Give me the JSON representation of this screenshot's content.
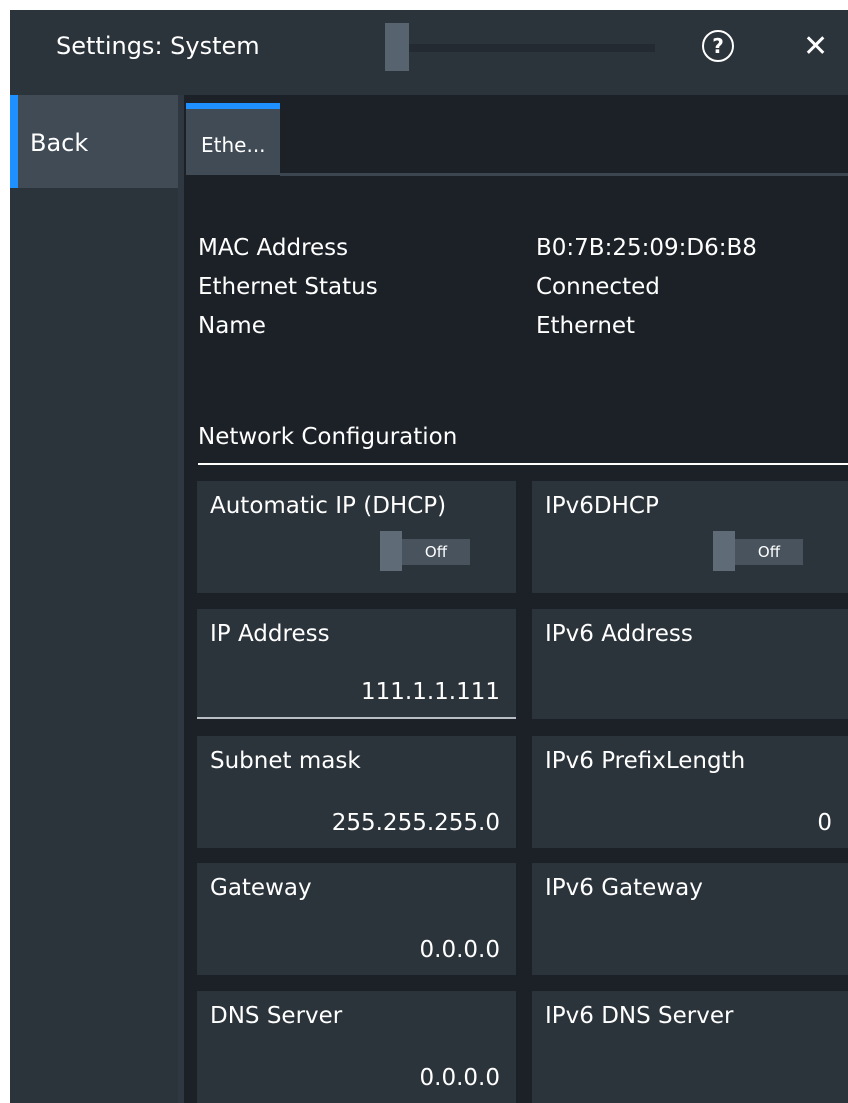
{
  "window": {
    "title": "Settings: System"
  },
  "icons": {
    "help": "?",
    "close": "✕"
  },
  "sidebar": {
    "back_label": "Back"
  },
  "tabs": [
    {
      "label": "Ethe..."
    }
  ],
  "info": {
    "mac_label": "MAC Address",
    "mac_value": "B0:7B:25:09:D6:B8",
    "status_label": "Ethernet Status",
    "status_value": "Connected",
    "name_label": "Name",
    "name_value": "Ethernet"
  },
  "network": {
    "section_title": "Network Configuration",
    "dhcp": {
      "label": "Automatic IP (DHCP)",
      "state": "Off"
    },
    "ipv6dhcp": {
      "label": "IPv6DHCP",
      "state": "Off"
    },
    "ip_address": {
      "label": "IP Address",
      "value": "111.1.1.111"
    },
    "ipv6_address": {
      "label": "IPv6 Address",
      "value": ""
    },
    "subnet_mask": {
      "label": "Subnet mask",
      "value": "255.255.255.0"
    },
    "ipv6_prefix": {
      "label": "IPv6 PrefixLength",
      "value": "0"
    },
    "gateway": {
      "label": "Gateway",
      "value": "0.0.0.0"
    },
    "ipv6_gateway": {
      "label": "IPv6 Gateway",
      "value": ""
    },
    "dns_server": {
      "label": "DNS Server",
      "value": "0.0.0.0"
    },
    "ipv6_dns_server": {
      "label": "IPv6 DNS Server",
      "value": ""
    }
  },
  "colors": {
    "accent": "#1e90ff",
    "background": "#1c2127",
    "panel": "#2b333b"
  }
}
